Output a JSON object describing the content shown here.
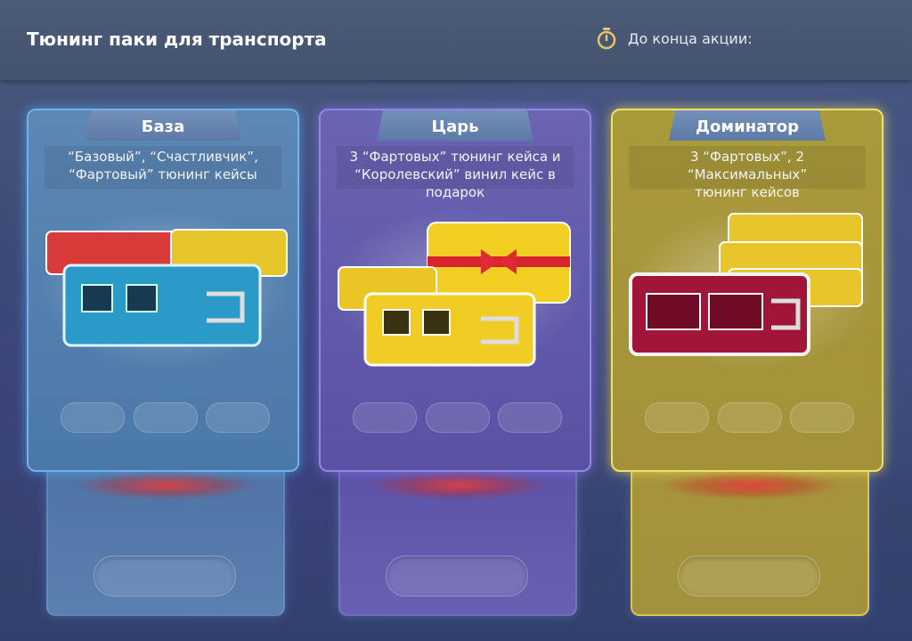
{
  "header": {
    "title": "Тюнинг паки для транспорта",
    "timer_label": "До конца акции:",
    "timer_icon": "stopwatch-icon"
  },
  "packs": [
    {
      "name": "База",
      "description": "“Базовый”, “Счастливчик”,\n“Фартовый” тюнинг кейсы",
      "theme": "blue",
      "accent": "#6fb2ec"
    },
    {
      "name": "Царь",
      "description": "3 “Фартовых” тюнинг кейса и\n“Королевский” винил кейс в подарок",
      "theme": "purple",
      "accent": "#8f88e3"
    },
    {
      "name": "Доминатор",
      "description": "3 “Фартовых”, 2 “Максимальных”\nтюнинг кейсов",
      "theme": "gold",
      "accent": "#efe06a"
    }
  ]
}
